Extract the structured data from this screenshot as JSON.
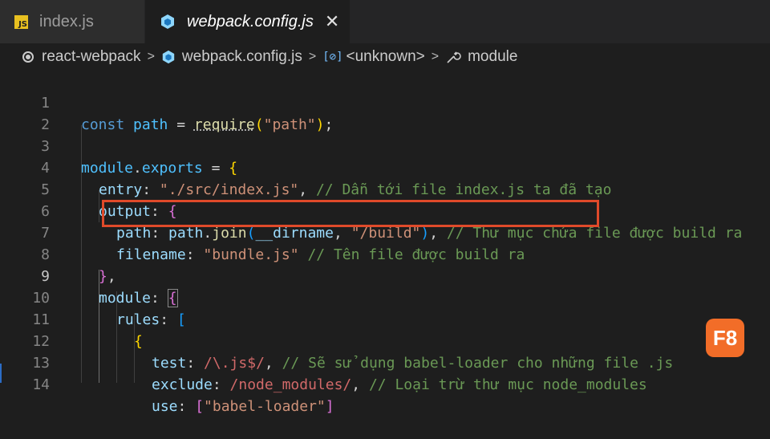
{
  "tabs": [
    {
      "label": "index.js",
      "icon": "js-file-icon",
      "icon_text": "JS"
    },
    {
      "label": "webpack.config.js",
      "icon": "webpack-cube-icon",
      "active": true
    }
  ],
  "breadcrumb": {
    "project": "react-webpack",
    "file": "webpack.config.js",
    "symbol": "<unknown>",
    "property": "module"
  },
  "code_lines": [
    {
      "n": "1"
    },
    {
      "n": "2"
    },
    {
      "n": "3"
    },
    {
      "n": "4"
    },
    {
      "n": "5"
    },
    {
      "n": "6"
    },
    {
      "n": "7"
    },
    {
      "n": "8"
    },
    {
      "n": "9"
    },
    {
      "n": "10"
    },
    {
      "n": "11"
    },
    {
      "n": "12"
    },
    {
      "n": "13"
    },
    {
      "n": "14"
    }
  ],
  "code": {
    "l1": {
      "kw": "const",
      "var": "path",
      "op": " = ",
      "fn": "require",
      "p1": "(",
      "str": "\"path\"",
      "p2": ")",
      "end": ";"
    },
    "l3": {
      "obj": "module",
      "dot": ".",
      "prop": "exports",
      "op": " = ",
      "br": "{"
    },
    "l4": {
      "prop": "entry",
      "colon": ": ",
      "str": "\"./src/index.js\"",
      "comma": ", ",
      "cmt": "// Dẫn tới file index.js ta đã tạo"
    },
    "l5": {
      "prop": "output",
      "colon": ": ",
      "br": "{"
    },
    "l6": {
      "prop": "path",
      "colon": ": ",
      "obj": "path",
      "dot": ".",
      "fn": "join",
      "p1": "(",
      "arg": "__dirname",
      "comma1": ", ",
      "str": "\"/build\"",
      "p2": ")",
      "comma2": ", ",
      "cmt": "// Thư mục chứa file được build ra"
    },
    "l7": {
      "prop": "filename",
      "colon": ": ",
      "str": "\"bundle.js\"",
      "sp": " ",
      "cmt": "// Tên file được build ra"
    },
    "l8": {
      "br": "}",
      "comma": ","
    },
    "l9": {
      "prop": "module",
      "colon": ": ",
      "br": "{"
    },
    "l10": {
      "prop": "rules",
      "colon": ": ",
      "br": "["
    },
    "l11": {
      "br": "{"
    },
    "l12": {
      "prop": "test",
      "colon": ": ",
      "re": "/\\.js$/",
      "comma": ", ",
      "cmt": "// Sẽ sử dụng babel-loader cho những file .js"
    },
    "l13": {
      "prop": "exclude",
      "colon": ": ",
      "re": "/node_modules/",
      "comma": ", ",
      "cmt": "// Loại trừ thư mục node_modules"
    },
    "l14": {
      "prop": "use",
      "colon": ": ",
      "br1": "[",
      "str": "\"babel-loader\"",
      "br2": "]"
    }
  },
  "badge": {
    "label": "F8"
  },
  "colors": {
    "highlight_box": "#e04a2a",
    "badge": "#f26d28",
    "keyword": "#569cd6",
    "string": "#ce9178",
    "comment": "#6a9955",
    "property": "#9cdcfe"
  }
}
